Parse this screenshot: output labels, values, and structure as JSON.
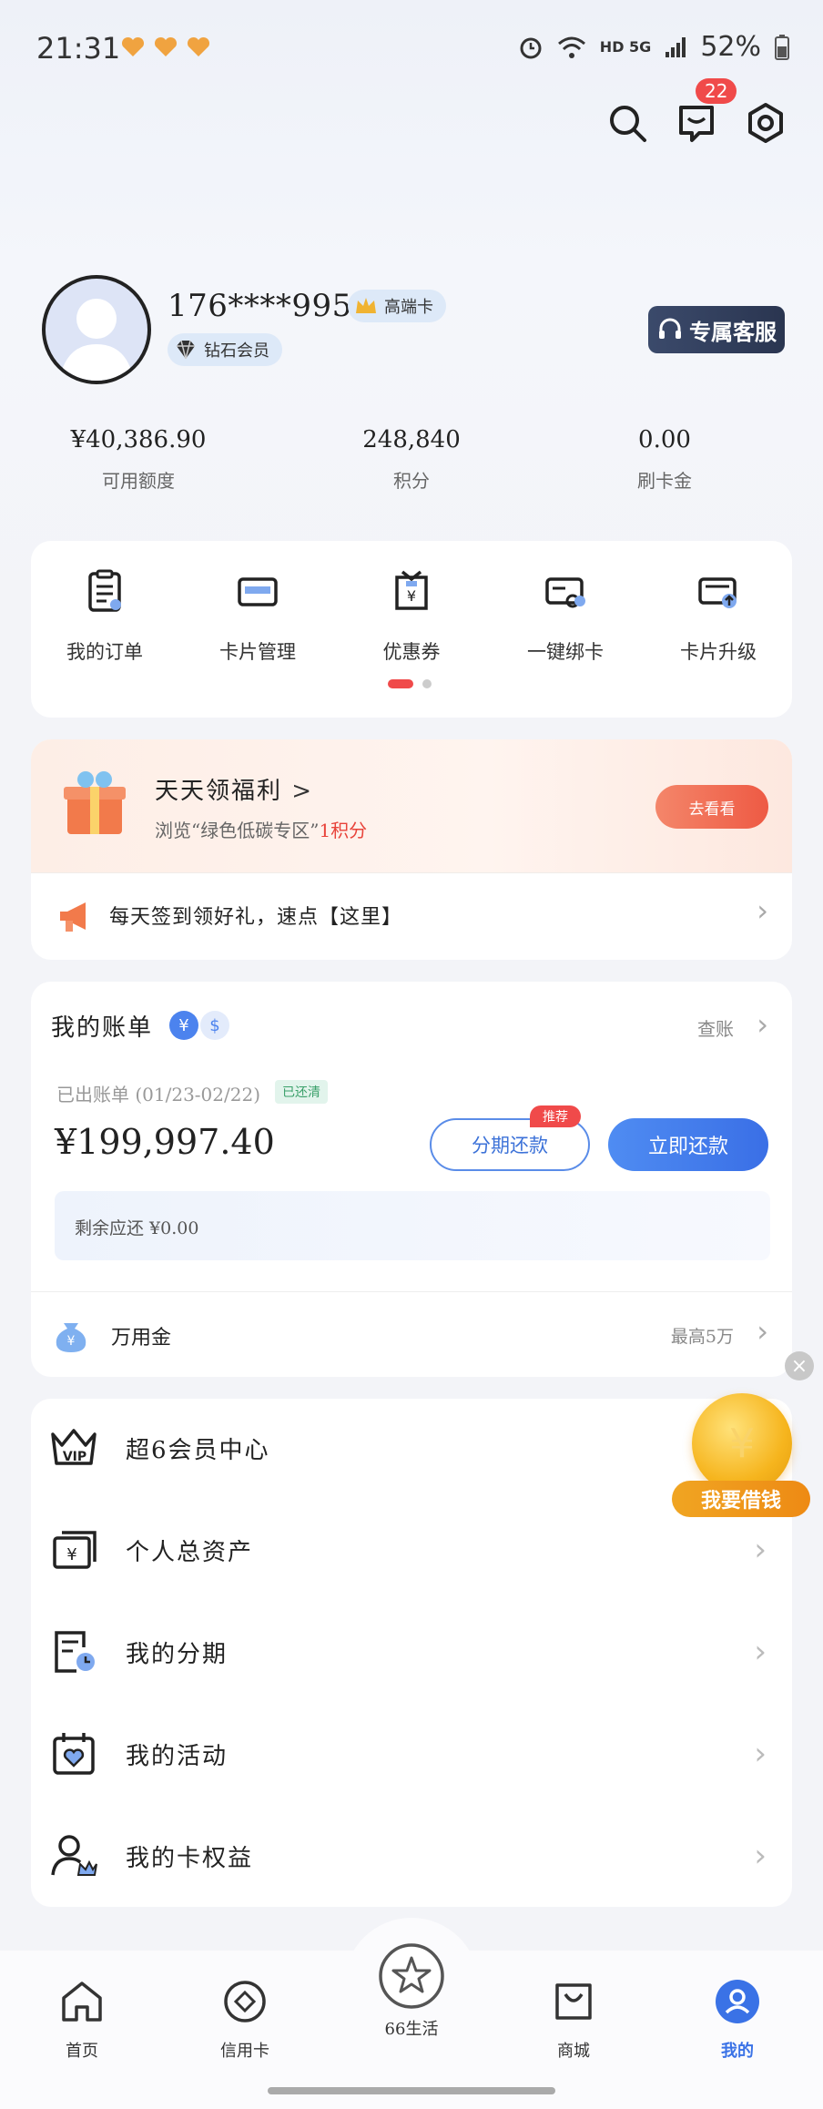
{
  "status_bar": {
    "time": "21:31",
    "network": "HD 5G",
    "battery": "52%"
  },
  "header": {
    "message_count": "22"
  },
  "profile": {
    "phone": "176****9956",
    "card_badge": "高端卡",
    "member_badge": "钻石会员",
    "service_button": "专属客服"
  },
  "stats": [
    {
      "value": "¥40,386.90",
      "label": "可用额度"
    },
    {
      "value": "248,840",
      "label": "积分"
    },
    {
      "value": "0.00",
      "label": "刷卡金"
    }
  ],
  "shortcuts": [
    {
      "label": "我的订单",
      "icon": "order-icon"
    },
    {
      "label": "卡片管理",
      "icon": "card-manage-icon"
    },
    {
      "label": "优惠券",
      "icon": "coupon-icon"
    },
    {
      "label": "一键绑卡",
      "icon": "bind-card-icon"
    },
    {
      "label": "卡片升级",
      "icon": "card-upgrade-icon"
    }
  ],
  "welfare": {
    "title": "天天领福利",
    "subtitle_prefix": "浏览“绿色低碳专区”",
    "subtitle_points": "1积分",
    "button": "去看看",
    "checkin": "每天签到领好礼，速点【这里】"
  },
  "bill": {
    "title": "我的账单",
    "currency_cny": "¥",
    "currency_usd": "$",
    "view_link": "查账",
    "period": "已出账单 (01/23-02/22)",
    "status_badge": "已还清",
    "amount": "¥199,997.40",
    "installment_button": "分期还款",
    "recommend_tag": "推荐",
    "repay_button": "立即还款",
    "remaining": "剩余应还 ¥0.00",
    "wanyongjin_label": "万用金",
    "wanyongjin_hint": "最高5万"
  },
  "menu": [
    {
      "label": "超6会员中心",
      "icon": "vip-crown-icon"
    },
    {
      "label": "个人总资产",
      "icon": "assets-icon"
    },
    {
      "label": "我的分期",
      "icon": "installment-icon"
    },
    {
      "label": "我的活动",
      "icon": "activity-calendar-icon"
    },
    {
      "label": "我的卡权益",
      "icon": "card-rights-icon"
    }
  ],
  "float_promo": {
    "label": "我要借钱"
  },
  "bottom_nav": [
    {
      "label": "首页",
      "icon": "home-icon"
    },
    {
      "label": "信用卡",
      "icon": "credit-card-icon"
    },
    {
      "label": "66生活",
      "icon": "star-icon"
    },
    {
      "label": "商城",
      "icon": "shopping-bag-icon"
    },
    {
      "label": "我的",
      "icon": "user-icon",
      "active": true
    }
  ],
  "colors": {
    "accent": "#3a6fe6",
    "danger": "#f04a4a",
    "welfare_button": "#f0644c"
  }
}
